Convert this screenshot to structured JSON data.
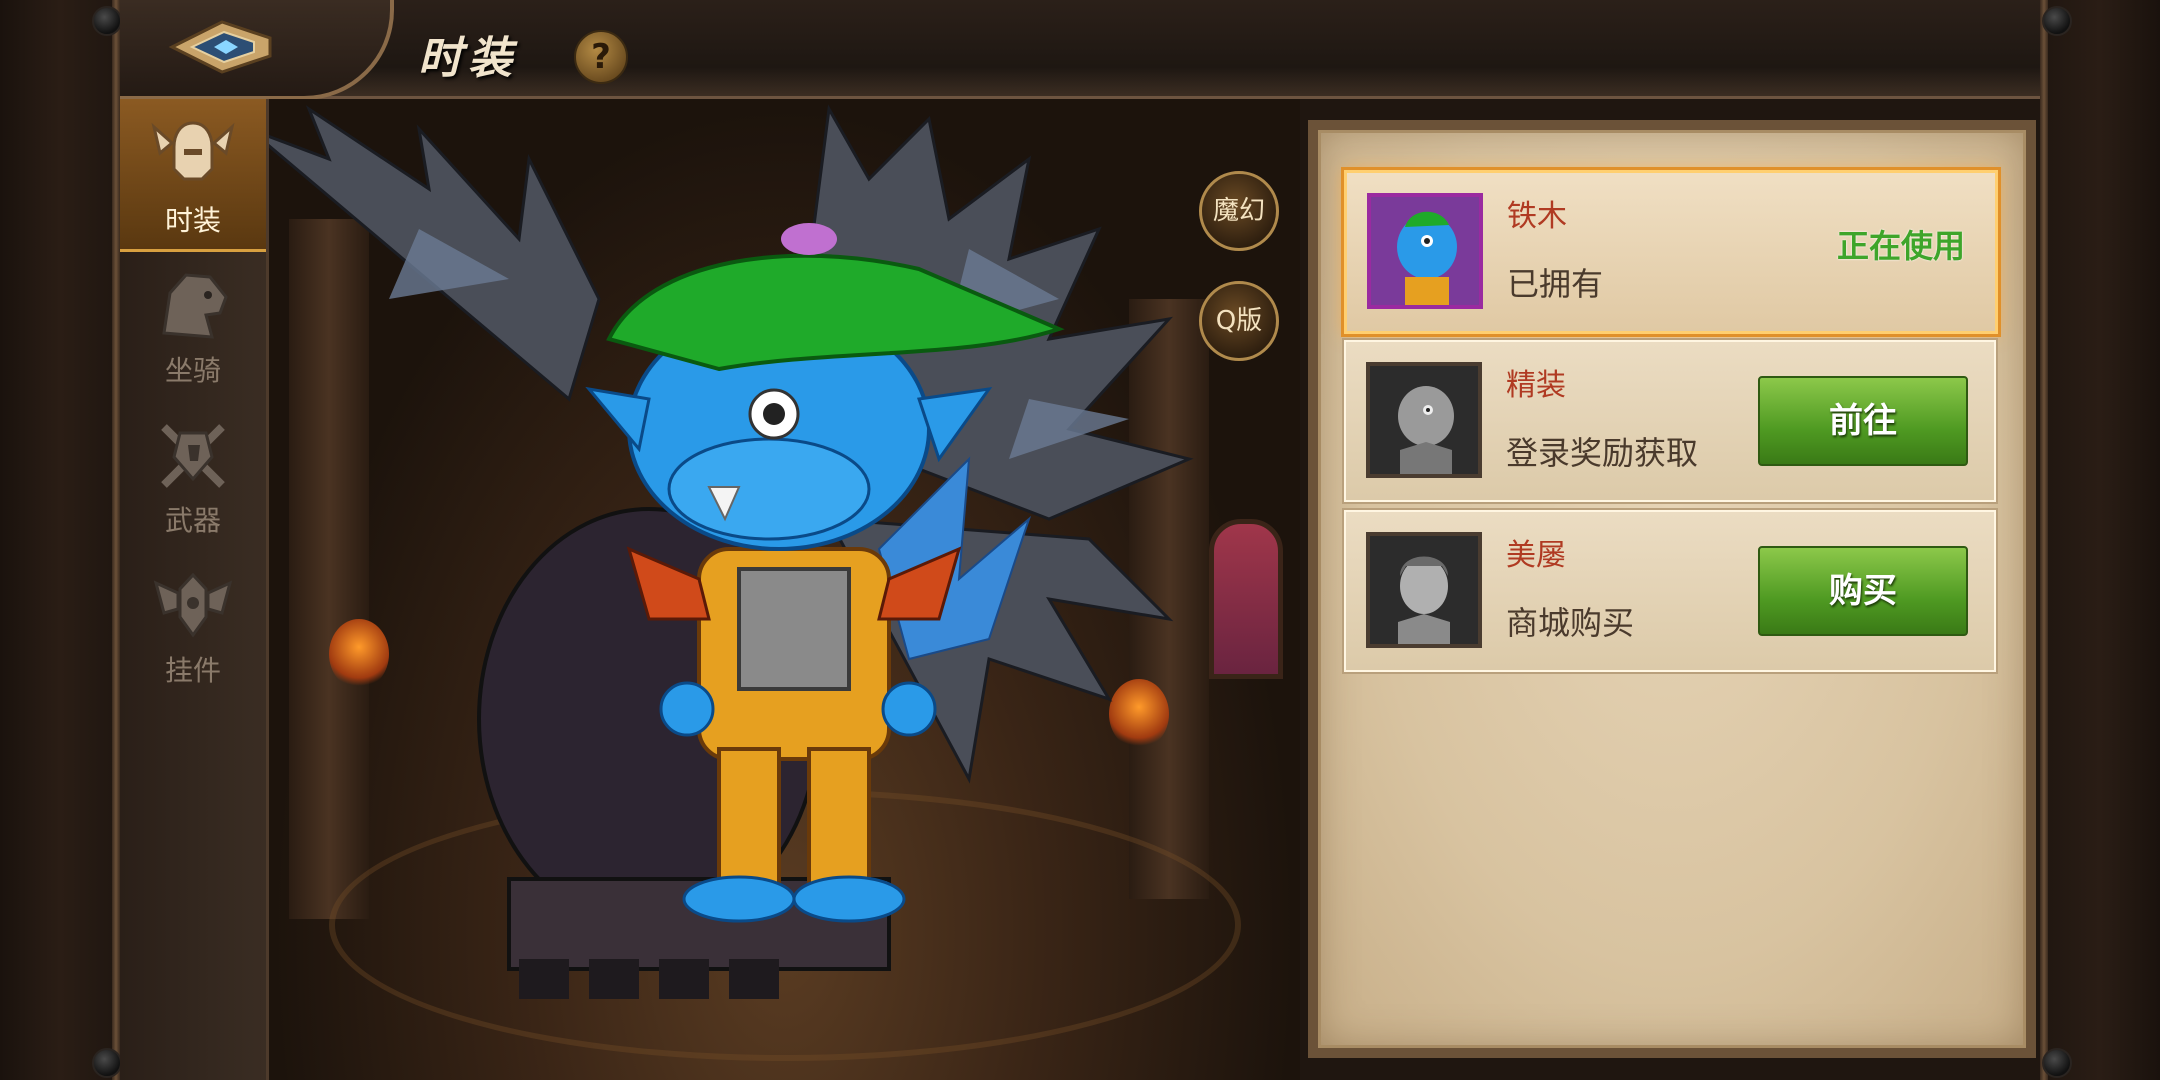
{
  "header": {
    "title": "时装",
    "help_label": "?"
  },
  "sidebar": {
    "items": [
      {
        "label": "时装",
        "icon": "winged-helmet-icon",
        "active": true
      },
      {
        "label": "坐骑",
        "icon": "mount-head-icon",
        "active": false
      },
      {
        "label": "武器",
        "icon": "crossed-weapons-icon",
        "active": false
      },
      {
        "label": "挂件",
        "icon": "winged-emblem-icon",
        "active": false
      }
    ]
  },
  "scene": {
    "mode_buttons": [
      {
        "label": "魔幻"
      },
      {
        "label": "Q版"
      }
    ]
  },
  "skins": [
    {
      "name": "铁木",
      "status": "已拥有",
      "state_label": "正在使用",
      "selected": true,
      "thumb": "blue-troll-portrait"
    },
    {
      "name": "精装",
      "status": "登录奖励获取",
      "action_label": "前往",
      "selected": false,
      "thumb": "gray-troll-portrait"
    },
    {
      "name": "美屡",
      "status": "商城购买",
      "action_label": "购买",
      "selected": false,
      "thumb": "gray-human-portrait"
    }
  ],
  "colors": {
    "accent_gold": "#d8a040",
    "name_red": "#b03a22",
    "using_green": "#3ea52a",
    "button_green": "#4f9a22",
    "selected_border": "#e0902a"
  }
}
